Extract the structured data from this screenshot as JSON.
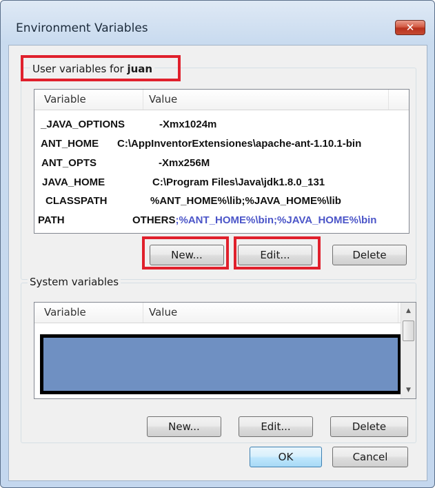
{
  "window": {
    "title": "Environment Variables",
    "close_glyph": "✕"
  },
  "user_vars": {
    "label_prefix": "User variables for ",
    "user": "juan",
    "headers": {
      "variable": "Variable",
      "value": "Value"
    },
    "rows": [
      {
        "name": "_JAVA_OPTIONS",
        "value": "-Xmx1024m"
      },
      {
        "name": "ANT_HOME",
        "value": "C:\\AppInventorExtensiones\\apache-ant-1.10.1-bin"
      },
      {
        "name": "ANT_OPTS",
        "value": "-Xmx256M"
      },
      {
        "name": "JAVA_HOME",
        "value": "C:\\Program Files\\Java\\jdk1.8.0_131"
      },
      {
        "name": "CLASSPATH",
        "value": "%ANT_HOME%\\lib;%JAVA_HOME%\\lib"
      },
      {
        "name": "PATH",
        "value_prefix": "OTHERS",
        "value_suffix": ";%ANT_HOME%\\bin;%JAVA_HOME%\\bin"
      }
    ],
    "buttons": {
      "new": "New...",
      "edit": "Edit...",
      "delete": "Delete"
    }
  },
  "system_vars": {
    "label": "System variables",
    "headers": {
      "variable": "Variable",
      "value": "Value"
    },
    "buttons": {
      "new": "New...",
      "edit": "Edit...",
      "delete": "Delete"
    }
  },
  "dialog_buttons": {
    "ok": "OK",
    "cancel": "Cancel"
  },
  "colors": {
    "highlight_red": "#e0202c",
    "path_value_blue": "#4b55c8",
    "selection_blue": "#6f90c2"
  }
}
